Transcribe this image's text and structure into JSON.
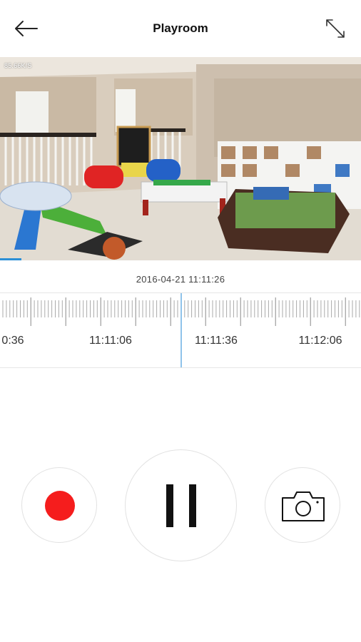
{
  "header": {
    "title": "Playroom",
    "back_icon": "arrow-left-icon",
    "expand_icon": "expand-arrows-icon"
  },
  "video": {
    "bitrate": "85.66K/S",
    "playback_progress": 0.06,
    "colors": {
      "progress": "#2b8fd6"
    }
  },
  "playback": {
    "datetime": "2016-04-21 11:11:26"
  },
  "timeline": {
    "labels": [
      "0:36",
      "11:11:06",
      "11:11:36",
      "11:12:06"
    ],
    "cursor_color": "#8fc3ea"
  },
  "controls": {
    "record_icon": "record-dot-icon",
    "pause_icon": "pause-icon",
    "snapshot_icon": "camera-icon",
    "record_color": "#f51d1d"
  }
}
